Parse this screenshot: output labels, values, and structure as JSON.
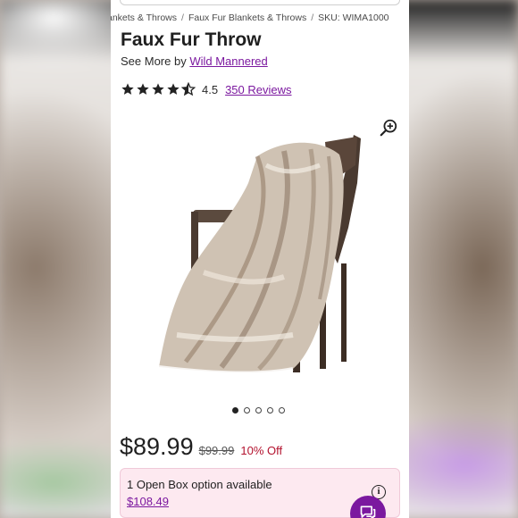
{
  "breadcrumb": {
    "items": [
      "ankets & Throws",
      "Faux Fur Blankets & Throws",
      "SKU: WIMA1000"
    ],
    "separator": "/"
  },
  "product": {
    "title": "Faux Fur Throw",
    "see_more_prefix": "See More by",
    "brand": "Wild Mannered",
    "rating": 4.5,
    "rating_text": "4.5",
    "reviews_text": "350 Reviews"
  },
  "gallery": {
    "image_icon": "faux-fur-throw-on-chair",
    "zoom_icon": "zoom-in-icon",
    "slide_count": 5,
    "active_slide": 1
  },
  "pricing": {
    "price": "$89.99",
    "original_price": "$99.99",
    "discount": "10% Off"
  },
  "open_box": {
    "text": "1 Open Box option available",
    "price": "$108.49",
    "info_icon": "i"
  },
  "colors": {
    "brand_purple": "#7b189f",
    "discount_red": "#b3122e",
    "open_box_bg": "#fde9f0",
    "star": "#222222"
  }
}
